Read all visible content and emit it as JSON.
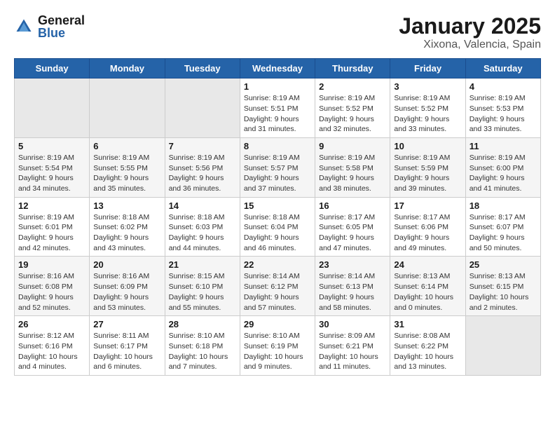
{
  "header": {
    "logo_general": "General",
    "logo_blue": "Blue",
    "title": "January 2025",
    "subtitle": "Xixona, Valencia, Spain"
  },
  "weekdays": [
    "Sunday",
    "Monday",
    "Tuesday",
    "Wednesday",
    "Thursday",
    "Friday",
    "Saturday"
  ],
  "weeks": [
    [
      {
        "day": "",
        "info": ""
      },
      {
        "day": "",
        "info": ""
      },
      {
        "day": "",
        "info": ""
      },
      {
        "day": "1",
        "info": "Sunrise: 8:19 AM\nSunset: 5:51 PM\nDaylight: 9 hours\nand 31 minutes."
      },
      {
        "day": "2",
        "info": "Sunrise: 8:19 AM\nSunset: 5:52 PM\nDaylight: 9 hours\nand 32 minutes."
      },
      {
        "day": "3",
        "info": "Sunrise: 8:19 AM\nSunset: 5:52 PM\nDaylight: 9 hours\nand 33 minutes."
      },
      {
        "day": "4",
        "info": "Sunrise: 8:19 AM\nSunset: 5:53 PM\nDaylight: 9 hours\nand 33 minutes."
      }
    ],
    [
      {
        "day": "5",
        "info": "Sunrise: 8:19 AM\nSunset: 5:54 PM\nDaylight: 9 hours\nand 34 minutes."
      },
      {
        "day": "6",
        "info": "Sunrise: 8:19 AM\nSunset: 5:55 PM\nDaylight: 9 hours\nand 35 minutes."
      },
      {
        "day": "7",
        "info": "Sunrise: 8:19 AM\nSunset: 5:56 PM\nDaylight: 9 hours\nand 36 minutes."
      },
      {
        "day": "8",
        "info": "Sunrise: 8:19 AM\nSunset: 5:57 PM\nDaylight: 9 hours\nand 37 minutes."
      },
      {
        "day": "9",
        "info": "Sunrise: 8:19 AM\nSunset: 5:58 PM\nDaylight: 9 hours\nand 38 minutes."
      },
      {
        "day": "10",
        "info": "Sunrise: 8:19 AM\nSunset: 5:59 PM\nDaylight: 9 hours\nand 39 minutes."
      },
      {
        "day": "11",
        "info": "Sunrise: 8:19 AM\nSunset: 6:00 PM\nDaylight: 9 hours\nand 41 minutes."
      }
    ],
    [
      {
        "day": "12",
        "info": "Sunrise: 8:19 AM\nSunset: 6:01 PM\nDaylight: 9 hours\nand 42 minutes."
      },
      {
        "day": "13",
        "info": "Sunrise: 8:18 AM\nSunset: 6:02 PM\nDaylight: 9 hours\nand 43 minutes."
      },
      {
        "day": "14",
        "info": "Sunrise: 8:18 AM\nSunset: 6:03 PM\nDaylight: 9 hours\nand 44 minutes."
      },
      {
        "day": "15",
        "info": "Sunrise: 8:18 AM\nSunset: 6:04 PM\nDaylight: 9 hours\nand 46 minutes."
      },
      {
        "day": "16",
        "info": "Sunrise: 8:17 AM\nSunset: 6:05 PM\nDaylight: 9 hours\nand 47 minutes."
      },
      {
        "day": "17",
        "info": "Sunrise: 8:17 AM\nSunset: 6:06 PM\nDaylight: 9 hours\nand 49 minutes."
      },
      {
        "day": "18",
        "info": "Sunrise: 8:17 AM\nSunset: 6:07 PM\nDaylight: 9 hours\nand 50 minutes."
      }
    ],
    [
      {
        "day": "19",
        "info": "Sunrise: 8:16 AM\nSunset: 6:08 PM\nDaylight: 9 hours\nand 52 minutes."
      },
      {
        "day": "20",
        "info": "Sunrise: 8:16 AM\nSunset: 6:09 PM\nDaylight: 9 hours\nand 53 minutes."
      },
      {
        "day": "21",
        "info": "Sunrise: 8:15 AM\nSunset: 6:10 PM\nDaylight: 9 hours\nand 55 minutes."
      },
      {
        "day": "22",
        "info": "Sunrise: 8:14 AM\nSunset: 6:12 PM\nDaylight: 9 hours\nand 57 minutes."
      },
      {
        "day": "23",
        "info": "Sunrise: 8:14 AM\nSunset: 6:13 PM\nDaylight: 9 hours\nand 58 minutes."
      },
      {
        "day": "24",
        "info": "Sunrise: 8:13 AM\nSunset: 6:14 PM\nDaylight: 10 hours\nand 0 minutes."
      },
      {
        "day": "25",
        "info": "Sunrise: 8:13 AM\nSunset: 6:15 PM\nDaylight: 10 hours\nand 2 minutes."
      }
    ],
    [
      {
        "day": "26",
        "info": "Sunrise: 8:12 AM\nSunset: 6:16 PM\nDaylight: 10 hours\nand 4 minutes."
      },
      {
        "day": "27",
        "info": "Sunrise: 8:11 AM\nSunset: 6:17 PM\nDaylight: 10 hours\nand 6 minutes."
      },
      {
        "day": "28",
        "info": "Sunrise: 8:10 AM\nSunset: 6:18 PM\nDaylight: 10 hours\nand 7 minutes."
      },
      {
        "day": "29",
        "info": "Sunrise: 8:10 AM\nSunset: 6:19 PM\nDaylight: 10 hours\nand 9 minutes."
      },
      {
        "day": "30",
        "info": "Sunrise: 8:09 AM\nSunset: 6:21 PM\nDaylight: 10 hours\nand 11 minutes."
      },
      {
        "day": "31",
        "info": "Sunrise: 8:08 AM\nSunset: 6:22 PM\nDaylight: 10 hours\nand 13 minutes."
      },
      {
        "day": "",
        "info": ""
      }
    ]
  ]
}
